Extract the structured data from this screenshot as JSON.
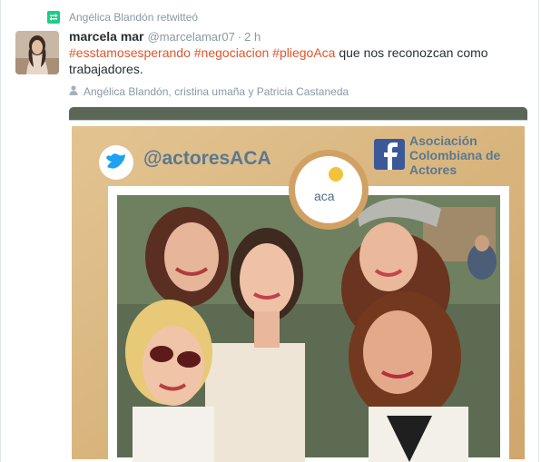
{
  "context": {
    "text": "Angélica Blandón retwitteó"
  },
  "author": {
    "fullname": "marcela mar",
    "username": "@marcelamar07",
    "separator": "·",
    "time": "2 h"
  },
  "tweet": {
    "hashtags": [
      "#esstamosesperando",
      "#negociacion",
      "#pliegoAca"
    ],
    "text_rest": "que nos reconozcan como trabajadores."
  },
  "tagged": {
    "text": "Angélica Blandón, cristina umaña y Patricia Castaneda"
  },
  "media": {
    "handle": "@actoresACA",
    "org_line1": "Asociación",
    "org_line2": "Colombiana de",
    "org_line3": "Actores",
    "badge": "aca"
  },
  "colors": {
    "hashtag": "#e0542b",
    "retweet": "#19cf86",
    "muted": "#8899a6"
  },
  "icons": {
    "context": "retweet-icon",
    "tagged": "person-icon"
  }
}
